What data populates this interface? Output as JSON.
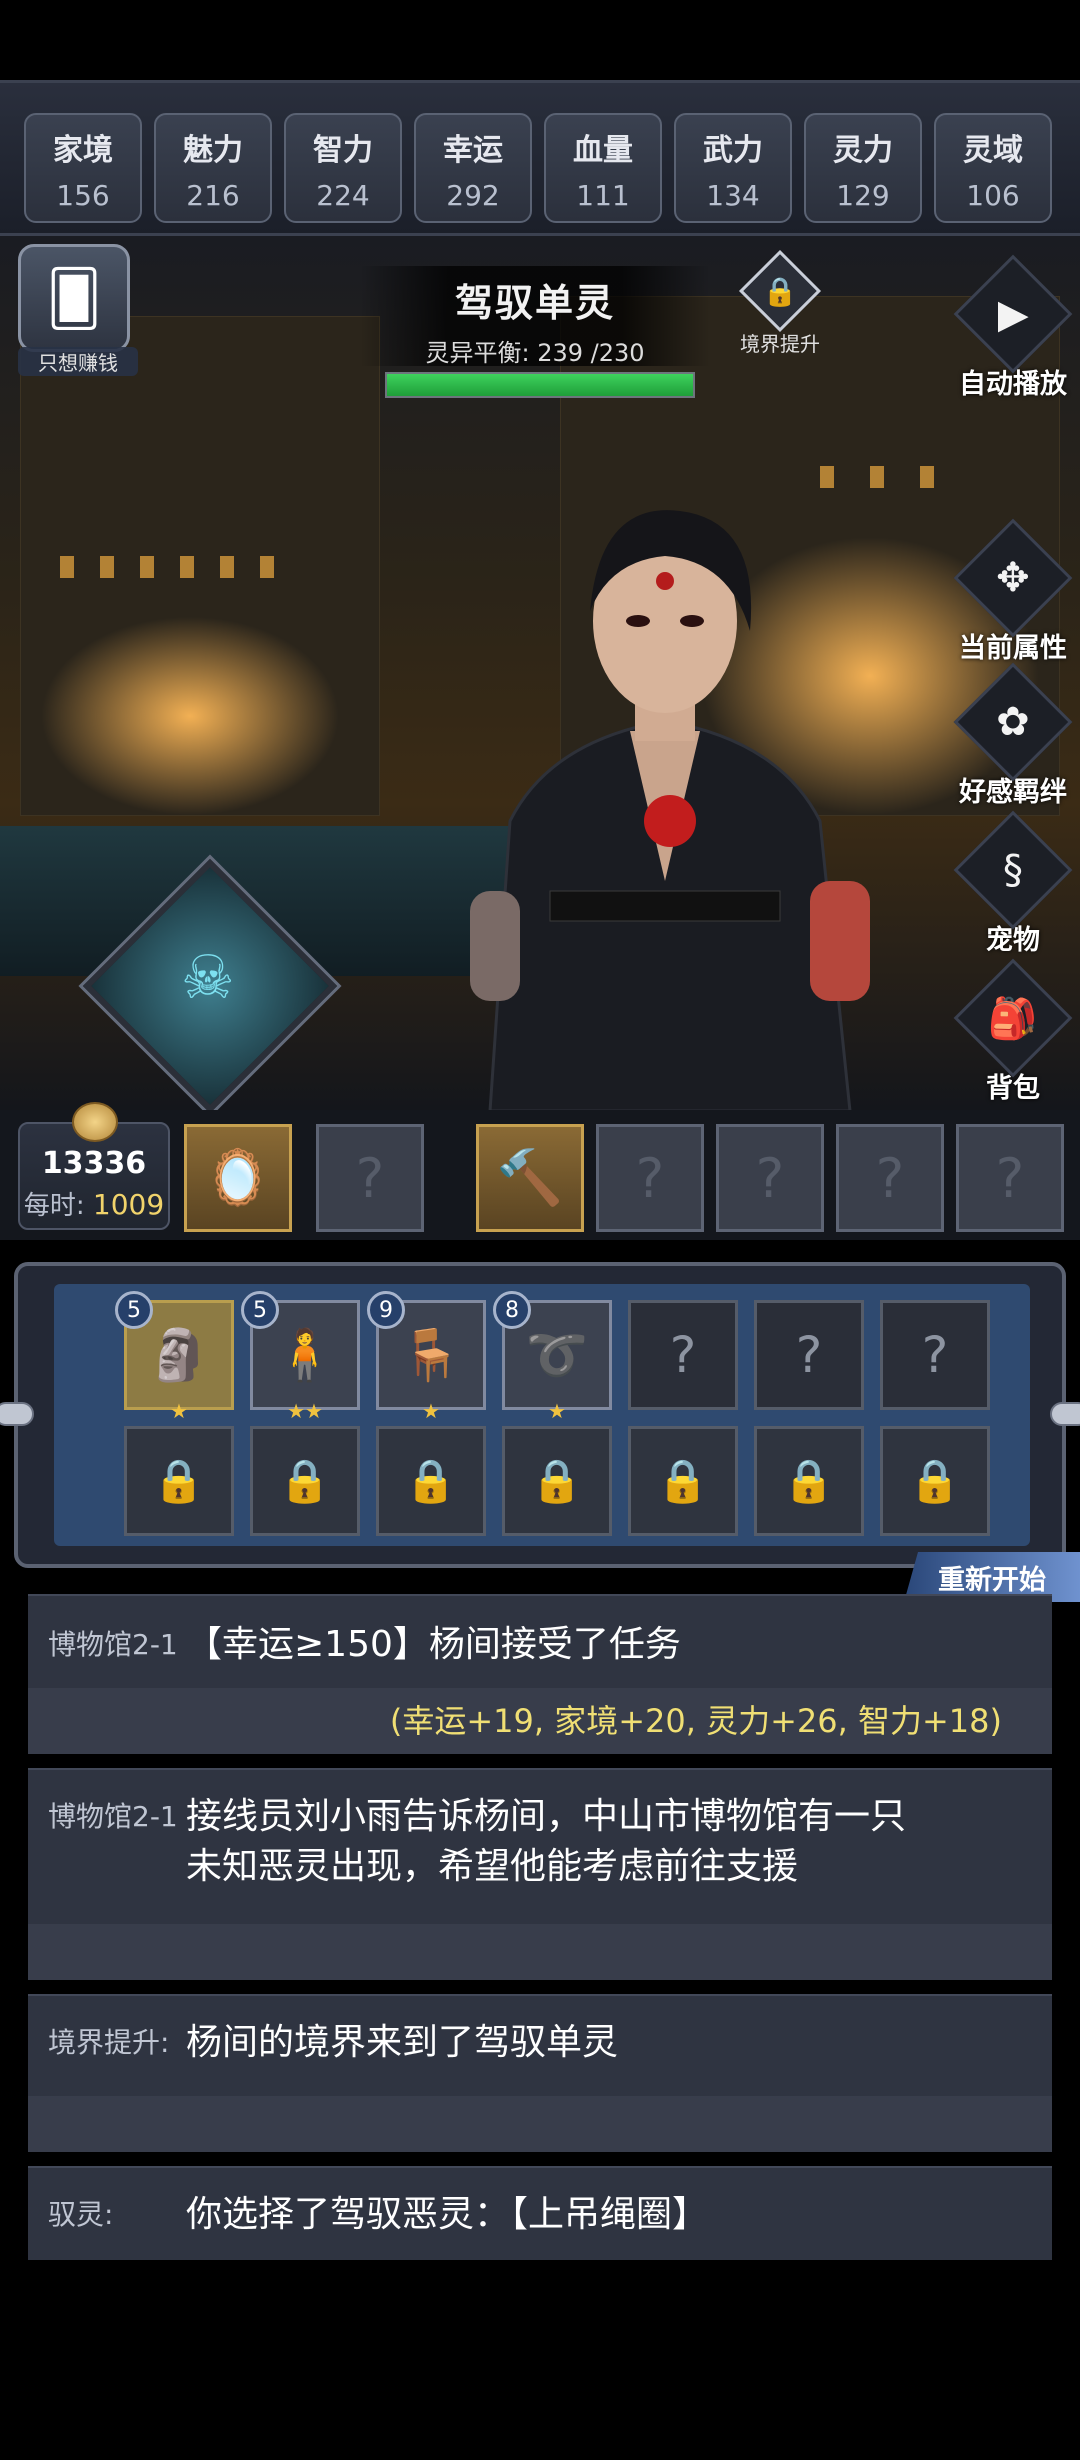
{
  "stats": [
    {
      "label": "家境",
      "value": "156"
    },
    {
      "label": "魅力",
      "value": "216"
    },
    {
      "label": "智力",
      "value": "224"
    },
    {
      "label": "幸运",
      "value": "292"
    },
    {
      "label": "血量",
      "value": "111"
    },
    {
      "label": "武力",
      "value": "134"
    },
    {
      "label": "灵力",
      "value": "129"
    },
    {
      "label": "灵域",
      "value": "106"
    }
  ],
  "header": {
    "realm_title": "驾驭单灵",
    "balance_label": "灵异平衡:",
    "balance_value": "239 /230",
    "hp_fraction": 1.0,
    "realm_up_label": "境界提升",
    "earn_label": "只想赚钱"
  },
  "side_buttons": [
    {
      "label": "自动播放",
      "icon": "play-icon"
    },
    {
      "label": "当前属性",
      "icon": "emblem-icon"
    },
    {
      "label": "好感羁绊",
      "icon": "flower-icon"
    },
    {
      "label": "宠物",
      "icon": "swirl-icon"
    },
    {
      "label": "背包",
      "icon": "backpack-icon"
    }
  ],
  "coins": {
    "amount": "13336",
    "rate_label": "每时:",
    "rate": "1009"
  },
  "inventory": {
    "items": [
      {
        "badge": "5",
        "stars": "★",
        "icon": "stone-head-icon"
      },
      {
        "badge": "5",
        "stars": "★★",
        "icon": "figure-icon"
      },
      {
        "badge": "9",
        "stars": "★",
        "icon": "chair-icon"
      },
      {
        "badge": "8",
        "stars": "★",
        "icon": "rope-icon"
      }
    ]
  },
  "restart_label": "重新开始",
  "log": [
    {
      "tag": "博物馆2-1",
      "text": "【幸运≥150】杨间接受了任务",
      "effect": "(幸运+19, 家境+20, 灵力+26, 智力+18)"
    },
    {
      "tag": "博物馆2-1",
      "text_line1": "接线员刘小雨告诉杨间，中山市博物馆有一只",
      "text_line2": "未知恶灵出现，希望他能考虑前往支援"
    },
    {
      "tag": "境界提升:",
      "text": "杨间的境界来到了驾驭单灵"
    },
    {
      "tag": "驭灵:",
      "text": "你选择了驾驭恶灵：【上吊绳圈】"
    }
  ]
}
